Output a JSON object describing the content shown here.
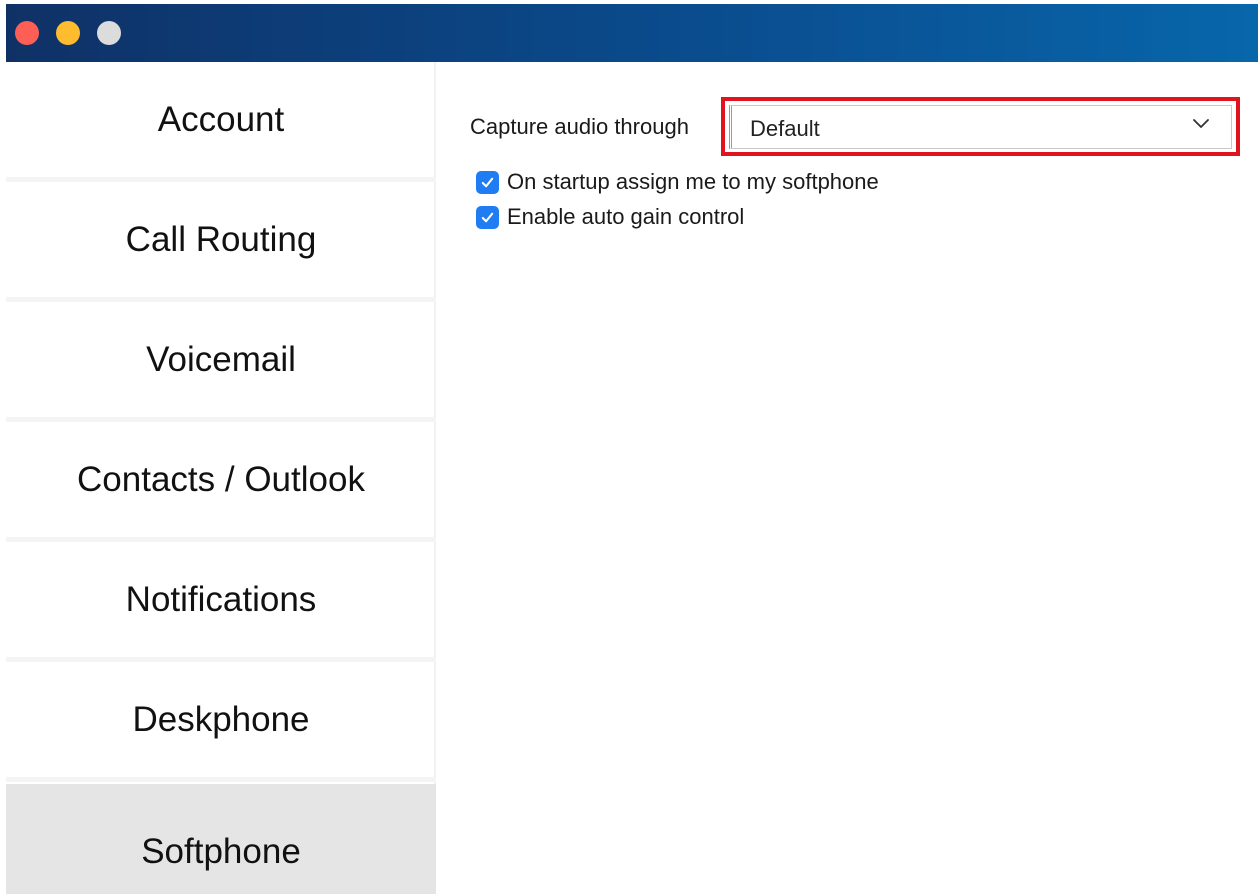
{
  "window": {
    "traffic_lights": [
      "close-button",
      "minimize-button",
      "zoom-button"
    ]
  },
  "sidebar": {
    "items": [
      {
        "label": "Account",
        "active": false
      },
      {
        "label": "Call Routing",
        "active": false
      },
      {
        "label": "Voicemail",
        "active": false
      },
      {
        "label": "Contacts / Outlook",
        "active": false
      },
      {
        "label": "Notifications",
        "active": false
      },
      {
        "label": "Deskphone",
        "active": false
      },
      {
        "label": "Softphone",
        "active": true
      }
    ]
  },
  "softphone": {
    "capture_label": "Capture audio through",
    "capture_select": {
      "value": "Default"
    },
    "options": [
      {
        "label": "On startup assign me to my softphone",
        "checked": true
      },
      {
        "label": "Enable auto gain control",
        "checked": true
      }
    ]
  },
  "colors": {
    "titlebar_start": "#0f3166",
    "titlebar_end": "#0866aa",
    "checkbox": "#1f7cf2",
    "highlight": "#e0141e",
    "active_nav": "#e5e5e5"
  },
  "icons": {
    "dropdown": "chevron-down-icon",
    "checkbox": "checkmark-icon"
  }
}
